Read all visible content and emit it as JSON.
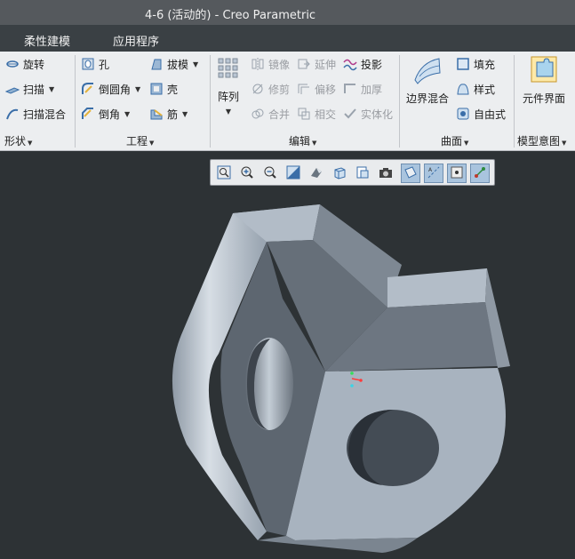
{
  "window": {
    "title": "4-6 (活动的) - Creo Parametric"
  },
  "tabs": [
    {
      "label": "柔性建模"
    },
    {
      "label": "应用程序"
    }
  ],
  "ribbon": {
    "shape": {
      "label": "形状",
      "revolve": "旋转",
      "sweep": "扫描",
      "swept_blend": "扫描混合"
    },
    "engineering": {
      "label": "工程",
      "hole": "孔",
      "round": "倒圆角",
      "chamfer": "倒角",
      "draft": "拔模",
      "shell": "壳",
      "rib": "筋"
    },
    "editing": {
      "label": "编辑",
      "pattern": "阵列",
      "mirror": "镜像",
      "trim": "修剪",
      "merge": "合并",
      "extend": "延伸",
      "offset": "偏移",
      "intersect": "相交",
      "project": "投影",
      "thicken": "加厚",
      "solidify": "实体化"
    },
    "surfaces": {
      "label": "曲面",
      "boundary_blend": "边界混合",
      "fill": "填充",
      "style": "样式",
      "freestyle": "自由式"
    },
    "model_intent": {
      "label": "模型意图",
      "component_interface": "元件界面"
    }
  },
  "colors": {
    "background": "#2d3235",
    "part_surface": "#a8b3bf",
    "ribbon": "#eceef0"
  }
}
